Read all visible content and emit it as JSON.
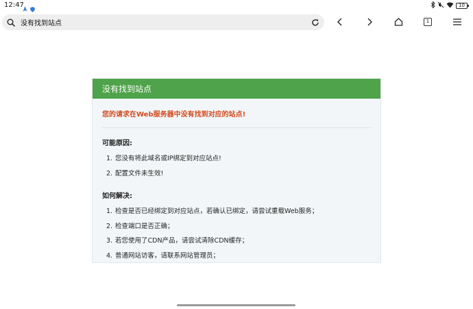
{
  "status_bar": {
    "time": "12:47",
    "battery": "10",
    "left_icons": [
      "person-arrow-icon",
      "shield-icon"
    ],
    "right_icons": [
      "bluetooth-icon",
      "mute-icon",
      "wifi-icon",
      "battery-icon"
    ]
  },
  "toolbar": {
    "address": "没有找到站点",
    "tab_count": "1",
    "icons": [
      "search-icon",
      "reload-icon",
      "back-icon",
      "forward-icon",
      "home-icon",
      "tabs-icon",
      "menu-icon"
    ]
  },
  "panel": {
    "header": "没有找到站点",
    "error_message": "您的请求在Web服务器中没有找到对应的站点!",
    "reasons_title": "可能原因:",
    "reasons": [
      {
        "num": "1.",
        "text": "您没有将此域名或IP绑定到对应站点!"
      },
      {
        "num": "2.",
        "text": "配置文件未生效!"
      }
    ],
    "solutions_title": "如何解决:",
    "solutions": [
      {
        "num": "1.",
        "text": "检查是否已经绑定到对应站点，若确认已绑定，请尝试重载Web服务；"
      },
      {
        "num": "2.",
        "text": "检查端口是否正确；"
      },
      {
        "num": "3.",
        "text": "若您使用了CDN产品，请尝试清除CDN缓存；"
      },
      {
        "num": "4.",
        "text": "普通网站访客，请联系网站管理员；"
      }
    ],
    "colors": {
      "header_bg": "#4fa34a",
      "error_text": "#d14b1f",
      "panel_bg": "#f3f6f8"
    }
  }
}
